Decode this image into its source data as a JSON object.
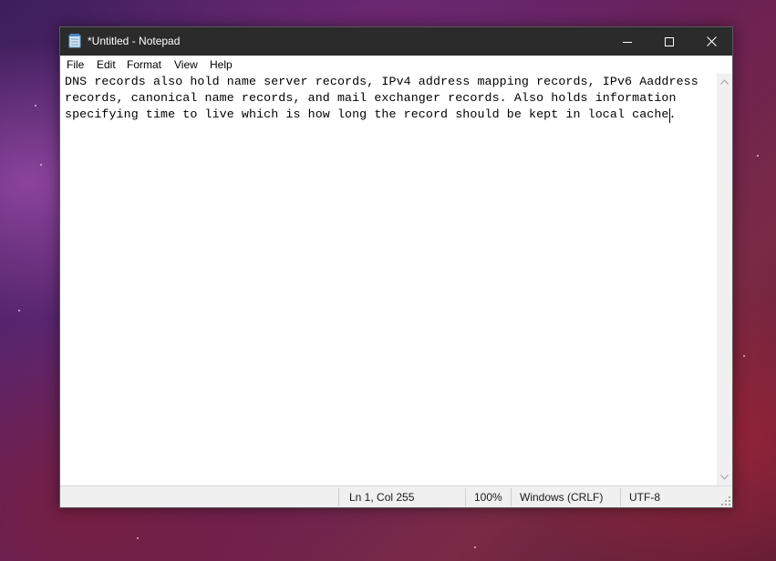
{
  "window": {
    "title": "*Untitled - Notepad",
    "controls": {
      "minimize": "minimize-icon",
      "maximize": "maximize-icon",
      "close": "close-icon"
    }
  },
  "menu": {
    "items": [
      {
        "label": "File"
      },
      {
        "label": "Edit"
      },
      {
        "label": "Format"
      },
      {
        "label": "View"
      },
      {
        "label": "Help"
      }
    ]
  },
  "editor": {
    "lines": [
      "DNS records also hold name server records, IPv4 address mapping records, IPv6 Aaddress",
      "records, canonical name records, and mail exchanger records. Also holds information",
      "specifying time to live which is how long the record should be kept in local cache."
    ]
  },
  "status": {
    "position": "Ln 1, Col 255",
    "zoom": "100%",
    "line_ending": "Windows (CRLF)",
    "encoding": "UTF-8"
  },
  "colors": {
    "titlebar": "#2b2b2b",
    "statusbar": "#f0f0f0",
    "editor_bg": "#ffffff"
  },
  "icons": [
    "notepad-app-icon",
    "minimize-icon",
    "maximize-icon",
    "close-icon",
    "scroll-up-arrow-icon",
    "scroll-down-arrow-icon",
    "resize-grip-icon"
  ]
}
